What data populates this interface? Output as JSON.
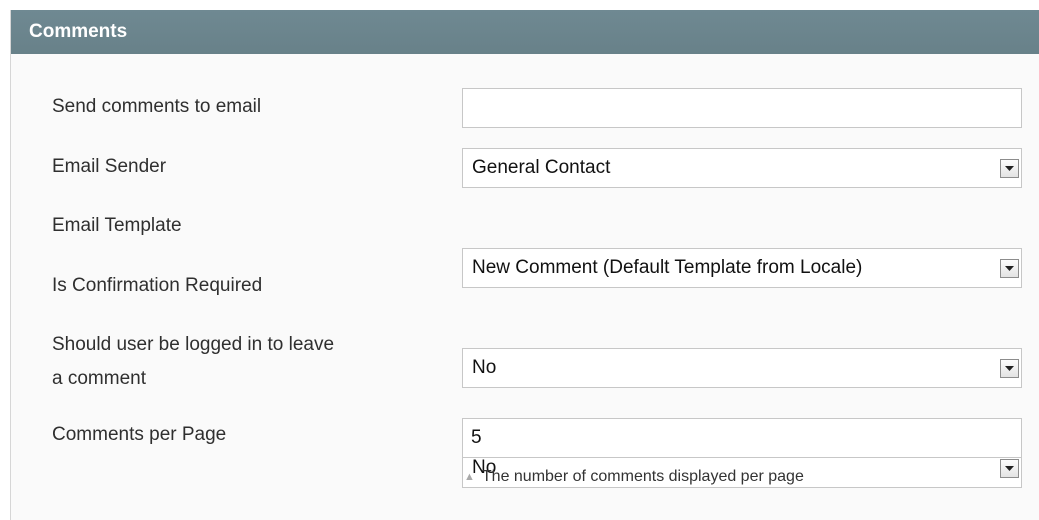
{
  "section": {
    "title": "Comments"
  },
  "fields": {
    "send_to_email": {
      "label": "Send comments to email",
      "value": ""
    },
    "email_sender": {
      "label": "Email Sender",
      "value": "General Contact"
    },
    "email_template": {
      "label": "Email Template",
      "value": "New Comment (Default Template from Locale)"
    },
    "confirmation_required": {
      "label": "Is Confirmation Required",
      "value": "No"
    },
    "logged_in_required": {
      "label_line1": "Should user be logged in to leave",
      "label_line2": "a comment",
      "value": "No"
    },
    "comments_per_page": {
      "label": "Comments per Page",
      "value": "5",
      "note": "The number of comments displayed per page"
    }
  },
  "icons": {
    "dropdown": "chevron-down-icon",
    "note": "triangle-up-icon"
  },
  "colors": {
    "header_bg": "#6f8992",
    "header_text": "#ffffff",
    "panel_bg": "#fafafa"
  }
}
